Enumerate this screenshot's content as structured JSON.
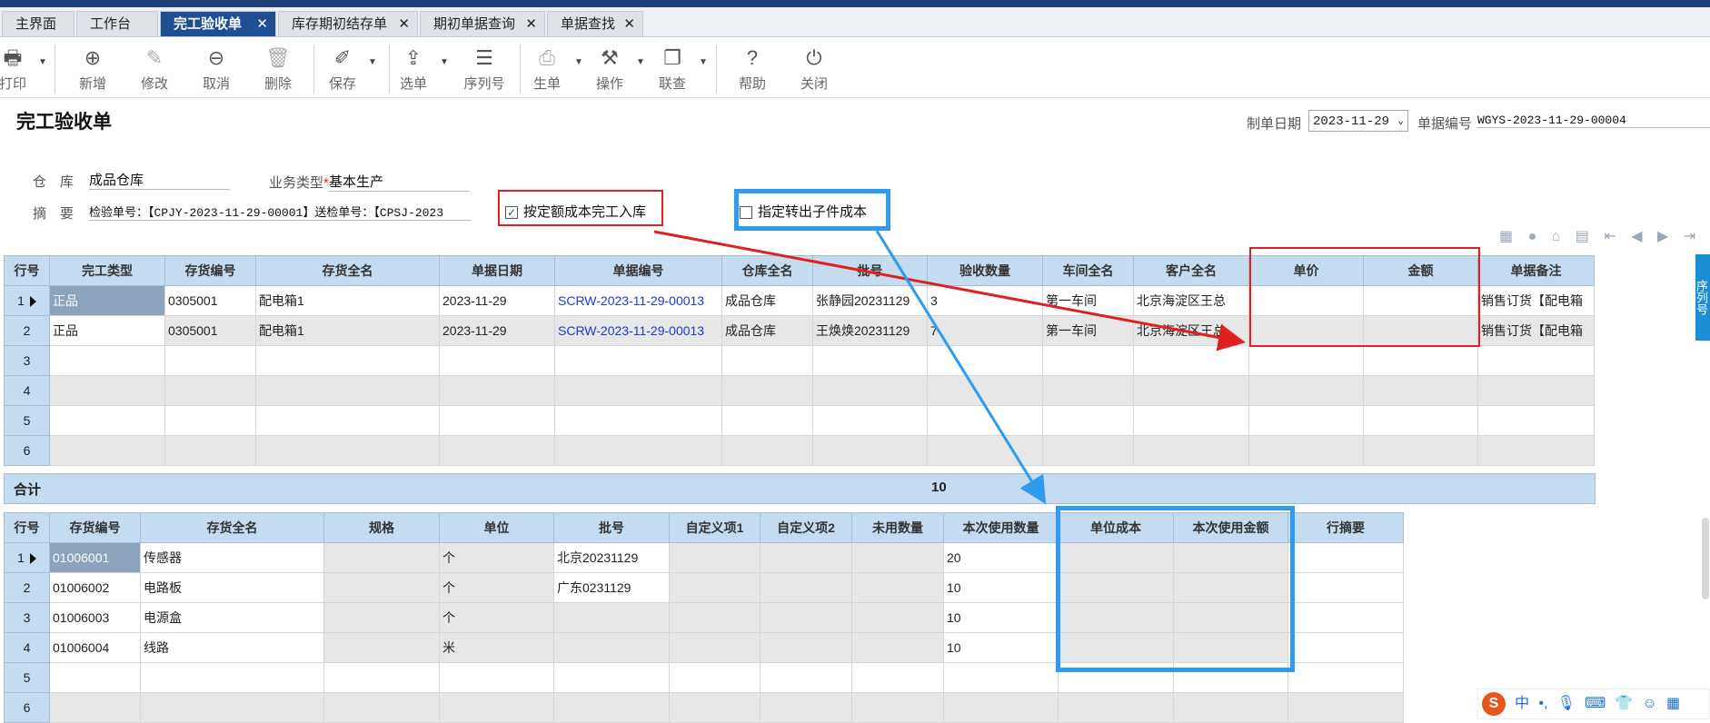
{
  "tabs": [
    {
      "label": "主界面",
      "closable": false
    },
    {
      "label": "工作台",
      "closable": false
    },
    {
      "label": "完工验收单",
      "closable": true,
      "active": true
    },
    {
      "label": "库存期初结存单",
      "closable": true
    },
    {
      "label": "期初单据查询",
      "closable": true
    },
    {
      "label": "单据查找",
      "closable": true
    }
  ],
  "tab_close_glyph": "✕",
  "toolbar": {
    "print": "打印",
    "add": "新增",
    "edit": "修改",
    "cancel": "取消",
    "delete": "删除",
    "save": "保存",
    "select_doc": "选单",
    "serial": "序列号",
    "gen_doc": "生单",
    "operate": "操作",
    "link_query": "联查",
    "help": "帮助",
    "close": "关闭"
  },
  "form": {
    "title": "完工验收单",
    "make_date_label": "制单日期",
    "make_date": "2023-11-29",
    "doc_no_label": "单据编号",
    "doc_no": "WGYS-2023-11-29-00004",
    "warehouse_label": "仓　库",
    "warehouse": "成品仓库",
    "biz_type_label": "业务类型",
    "required_mark": "*",
    "biz_type": "基本生产",
    "summary_label": "摘　要",
    "summary": "检验单号：【CPJY-2023-11-29-00001】送检单号：【CPSJ-2023",
    "opt_quota_cost": "按定额成本完工入库",
    "opt_quota_cost_checked": true,
    "opt_child_cost": "指定转出子件成本",
    "opt_child_cost_checked": false
  },
  "top_grid": {
    "headers": [
      "行号",
      "完工类型",
      "存货编号",
      "存货全名",
      "单据日期",
      "单据编号",
      "仓库全名",
      "批号",
      "验收数量",
      "车间全名",
      "客户全名",
      "单价",
      "金额",
      "单据备注"
    ],
    "rows": [
      [
        "1",
        "正品",
        "0305001",
        "配电箱1",
        "2023-11-29",
        "SCRW-2023-11-29-00013",
        "成品仓库",
        "张静园20231129",
        "3",
        "第一车间",
        "北京海淀区王总",
        "",
        "",
        "销售订货【配电箱"
      ],
      [
        "2",
        "正品",
        "0305001",
        "配电箱1",
        "2023-11-29",
        "SCRW-2023-11-29-00013",
        "成品仓库",
        "王焕焕20231129",
        "7",
        "第一车间",
        "北京海淀区王总",
        "",
        "",
        "销售订货【配电箱"
      ],
      [
        "3",
        "",
        "",
        "",
        "",
        "",
        "",
        "",
        "",
        "",
        "",
        "",
        "",
        ""
      ],
      [
        "4",
        "",
        "",
        "",
        "",
        "",
        "",
        "",
        "",
        "",
        "",
        "",
        "",
        ""
      ],
      [
        "5",
        "",
        "",
        "",
        "",
        "",
        "",
        "",
        "",
        "",
        "",
        "",
        "",
        ""
      ],
      [
        "6",
        "",
        "",
        "",
        "",
        "",
        "",
        "",
        "",
        "",
        "",
        "",
        "",
        ""
      ]
    ],
    "sum_label": "合计",
    "sum_qty": "10"
  },
  "bottom_grid": {
    "headers": [
      "行号",
      "存货编号",
      "存货全名",
      "规格",
      "单位",
      "批号",
      "自定义项1",
      "自定义项2",
      "未用数量",
      "本次使用数量",
      "单位成本",
      "本次使用金额",
      "行摘要"
    ],
    "rows": [
      [
        "1",
        "01006001",
        "传感器",
        "",
        "个",
        "北京20231129",
        "",
        "",
        "",
        "20",
        "",
        "",
        ""
      ],
      [
        "2",
        "01006002",
        "电路板",
        "",
        "个",
        "广东0231129",
        "",
        "",
        "",
        "10",
        "",
        "",
        ""
      ],
      [
        "3",
        "01006003",
        "电源盒",
        "",
        "个",
        "",
        "",
        "",
        "",
        "10",
        "",
        "",
        ""
      ],
      [
        "4",
        "01006004",
        "线路",
        "",
        "米",
        "",
        "",
        "",
        "",
        "10",
        "",
        "",
        ""
      ],
      [
        "5",
        "",
        "",
        "",
        "",
        "",
        "",
        "",
        "",
        "",
        "",
        "",
        ""
      ],
      [
        "6",
        "",
        "",
        "",
        "",
        "",
        "",
        "",
        "",
        "",
        "",
        "",
        ""
      ]
    ]
  },
  "side_tab": "序列号",
  "ime": {
    "logo": "S",
    "mode": "中"
  },
  "colors": {
    "accent": "#1e4f92",
    "highlight_red": "#e02020",
    "highlight_blue": "#2d9bf0",
    "header_bg": "#c5dbef"
  }
}
